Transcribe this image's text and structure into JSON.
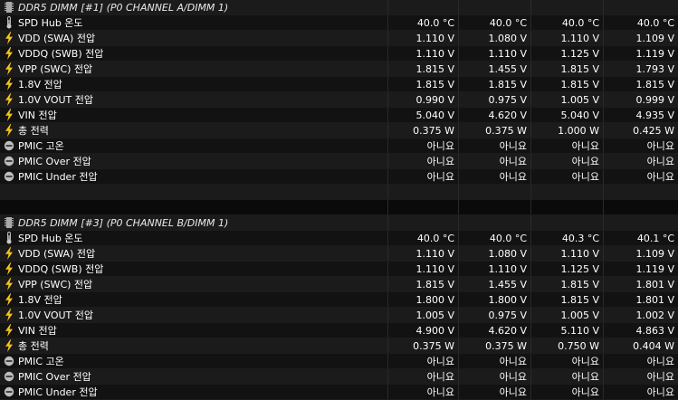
{
  "sections": [
    {
      "title": "DDR5 DIMM [#1] (P0 CHANNEL A/DIMM 1)",
      "rows": [
        {
          "icon": "thermometer-icon",
          "label": "SPD Hub 온도",
          "values": [
            "40.0 °C",
            "40.0 °C",
            "40.0 °C",
            "40.0 °C"
          ]
        },
        {
          "icon": "lightning-icon",
          "label": "VDD (SWA) 전압",
          "values": [
            "1.110 V",
            "1.080 V",
            "1.110 V",
            "1.109 V"
          ]
        },
        {
          "icon": "lightning-icon",
          "label": "VDDQ (SWB) 전압",
          "values": [
            "1.110 V",
            "1.110 V",
            "1.125 V",
            "1.119 V"
          ]
        },
        {
          "icon": "lightning-icon",
          "label": "VPP (SWC) 전압",
          "values": [
            "1.815 V",
            "1.455 V",
            "1.815 V",
            "1.793 V"
          ]
        },
        {
          "icon": "lightning-icon",
          "label": "1.8V 전압",
          "values": [
            "1.815 V",
            "1.815 V",
            "1.815 V",
            "1.815 V"
          ]
        },
        {
          "icon": "lightning-icon",
          "label": "1.0V VOUT 전압",
          "values": [
            "0.990 V",
            "0.975 V",
            "1.005 V",
            "0.999 V"
          ]
        },
        {
          "icon": "lightning-icon",
          "label": "VIN 전압",
          "values": [
            "5.040 V",
            "4.620 V",
            "5.040 V",
            "4.935 V"
          ]
        },
        {
          "icon": "lightning-icon",
          "label": "총 전력",
          "values": [
            "0.375 W",
            "0.375 W",
            "1.000 W",
            "0.425 W"
          ]
        },
        {
          "icon": "status-circle-icon",
          "label": "PMIC 고온",
          "values": [
            "아니요",
            "아니요",
            "아니요",
            "아니요"
          ]
        },
        {
          "icon": "status-circle-icon",
          "label": "PMIC Over 전압",
          "values": [
            "아니요",
            "아니요",
            "아니요",
            "아니요"
          ]
        },
        {
          "icon": "status-circle-icon",
          "label": "PMIC Under 전압",
          "values": [
            "아니요",
            "아니요",
            "아니요",
            "아니요"
          ]
        }
      ]
    },
    {
      "title": "DDR5 DIMM [#3] (P0 CHANNEL B/DIMM 1)",
      "rows": [
        {
          "icon": "thermometer-icon",
          "label": "SPD Hub 온도",
          "values": [
            "40.0 °C",
            "40.0 °C",
            "40.3 °C",
            "40.1 °C"
          ]
        },
        {
          "icon": "lightning-icon",
          "label": "VDD (SWA) 전압",
          "values": [
            "1.110 V",
            "1.080 V",
            "1.110 V",
            "1.109 V"
          ]
        },
        {
          "icon": "lightning-icon",
          "label": "VDDQ (SWB) 전압",
          "values": [
            "1.110 V",
            "1.110 V",
            "1.125 V",
            "1.119 V"
          ]
        },
        {
          "icon": "lightning-icon",
          "label": "VPP (SWC) 전압",
          "values": [
            "1.815 V",
            "1.455 V",
            "1.815 V",
            "1.801 V"
          ]
        },
        {
          "icon": "lightning-icon",
          "label": "1.8V 전압",
          "values": [
            "1.800 V",
            "1.800 V",
            "1.815 V",
            "1.801 V"
          ]
        },
        {
          "icon": "lightning-icon",
          "label": "1.0V VOUT 전압",
          "values": [
            "1.005 V",
            "0.975 V",
            "1.005 V",
            "1.002 V"
          ]
        },
        {
          "icon": "lightning-icon",
          "label": "VIN 전압",
          "values": [
            "4.900 V",
            "4.620 V",
            "5.110 V",
            "4.863 V"
          ]
        },
        {
          "icon": "lightning-icon",
          "label": "총 전력",
          "values": [
            "0.375 W",
            "0.375 W",
            "0.750 W",
            "0.404 W"
          ]
        },
        {
          "icon": "status-circle-icon",
          "label": "PMIC 고온",
          "values": [
            "아니요",
            "아니요",
            "아니요",
            "아니요"
          ]
        },
        {
          "icon": "status-circle-icon",
          "label": "PMIC Over 전압",
          "values": [
            "아니요",
            "아니요",
            "아니요",
            "아니요"
          ]
        },
        {
          "icon": "status-circle-icon",
          "label": "PMIC Under 전압",
          "values": [
            "아니요",
            "아니요",
            "아니요",
            "아니요"
          ]
        }
      ]
    }
  ],
  "colors": {
    "background": "#000000",
    "row_odd": "#121212",
    "row_even": "#1b1b1b",
    "text": "#ffffff",
    "lightning": "#f5c518",
    "thermometer": "#c8c8c8",
    "status_circle": "#bdbdbd"
  }
}
